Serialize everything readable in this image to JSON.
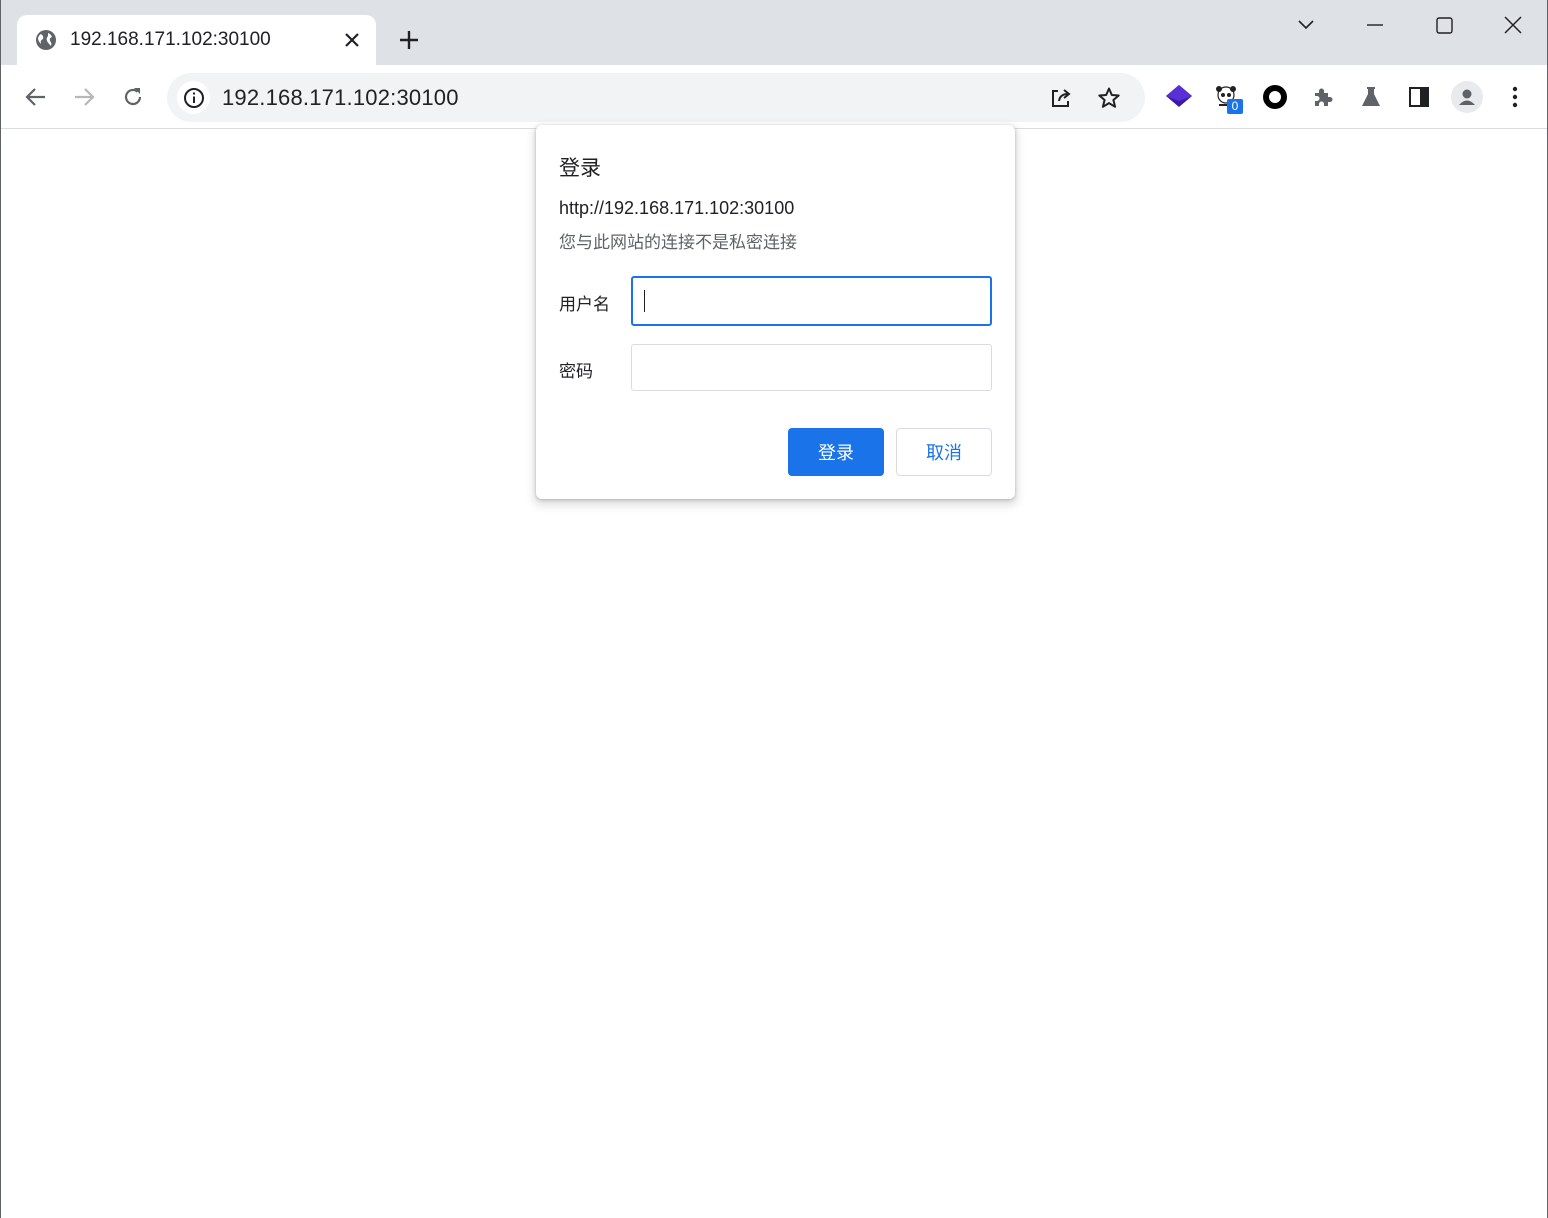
{
  "tab": {
    "title": "192.168.171.102:30100",
    "favicon": "globe-icon"
  },
  "window_controls": [
    "tab-search-icon",
    "minimize-icon",
    "maximize-icon",
    "close-icon"
  ],
  "toolbar": {
    "url": "192.168.171.102:30100",
    "extensions": [
      {
        "name": "layers-extension-icon"
      },
      {
        "name": "panda-extension-icon",
        "badge": "0"
      },
      {
        "name": "circle-extension-icon"
      },
      {
        "name": "extensions-puzzle-icon"
      },
      {
        "name": "labs-flask-icon"
      },
      {
        "name": "side-panel-icon"
      },
      {
        "name": "profile-avatar-icon"
      },
      {
        "name": "more-menu-icon"
      }
    ]
  },
  "dialog": {
    "title": "登录",
    "origin": "http://192.168.171.102:30100",
    "warning": "您与此网站的连接不是私密连接",
    "username_label": "用户名",
    "username_value": "",
    "password_label": "密码",
    "password_value": "",
    "login_button": "登录",
    "cancel_button": "取消"
  },
  "colors": {
    "accent": "#1a73e8",
    "tabstrip": "#dee1e6",
    "omnibox": "#f1f3f4"
  }
}
